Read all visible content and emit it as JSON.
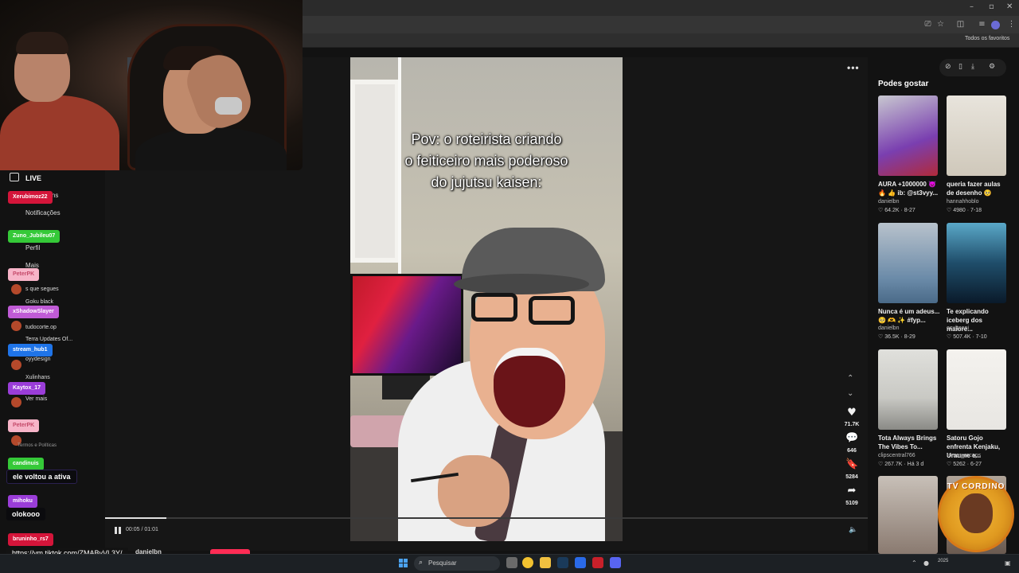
{
  "browser": {
    "bookmarks_label": "Todos os favoritos"
  },
  "sidebar": {
    "live_label": "LIVE",
    "items": [
      {
        "label": "Mensagens"
      },
      {
        "label": "Notificações"
      },
      {
        "label": "Perfil"
      },
      {
        "label": "Mais"
      }
    ],
    "following_heading": "s que segues",
    "following": [
      {
        "label": "Goku black"
      },
      {
        "label": "tudocorte.op"
      },
      {
        "label": "Terra Updates Of..."
      },
      {
        "label": "oyydesign"
      },
      {
        "label": "Xulinhans"
      }
    ],
    "see_more": "Ver mais",
    "footer": "Termos e Políticas"
  },
  "chat": {
    "messages": [
      {
        "user": "Xerubimoz22",
        "color": "#d4153a"
      },
      {
        "user": "Zuno_Jubileu07",
        "color": "#35c938"
      },
      {
        "user": "PeterPK",
        "color": "#f7b4c8"
      },
      {
        "user": "xShadowSlayer",
        "color": "#c05bd6"
      },
      {
        "user": "stream_hub1",
        "color": "#1f74e8"
      },
      {
        "user": "Kaytox_17",
        "color": "#9a3dd8"
      },
      {
        "user": "PeterPK",
        "color": "#f7b4c8"
      },
      {
        "user": "candinuis",
        "color": "#35c938",
        "text": "ele voltou a ativa"
      },
      {
        "user": "mihoku",
        "color": "#9a3dd8",
        "text": "olokooo"
      },
      {
        "user": "bruninho_rs7",
        "color": "#d4153a",
        "text": "https://vm.tiktok.com/ZMABvVL3Y/"
      }
    ]
  },
  "video": {
    "caption": "Pov: o roteirista criando\no feiticeiro mais poderoso\ndo jujutsu kaisen:",
    "time": "00:05 / 01:01",
    "progress": 0.08,
    "author": "danielbn",
    "actions": {
      "likes": "71.7K",
      "comments": "646",
      "saves": "5284",
      "shares": "5109"
    }
  },
  "recommendations": {
    "heading": "Podes gostar",
    "items": [
      {
        "title": "AURA +1000000 😈 🔥 👍 ib: @st3vyy...",
        "author": "danielbn",
        "likes": "64.2K",
        "date": "8-27",
        "thumb_color": "#7a3fb0"
      },
      {
        "title": "queria fazer aulas de desenho 🥺",
        "author": "hannahhoblo",
        "likes": "4980",
        "date": "7-18",
        "thumb_color": "#d8d2c8"
      },
      {
        "title": "Nunca é um adeus... 🥺 🫶 ✨ #fyp...",
        "author": "danielbn",
        "likes": "36.5K",
        "date": "8-29",
        "thumb_color": "#6a8aa8"
      },
      {
        "title": "Te explicando iceberg dos maiore...",
        "author": "ocultoeni",
        "likes": "507.4K",
        "date": "7-10",
        "thumb_color": "#1f4d6a"
      },
      {
        "title": "Tota Always Brings The Vibes To...",
        "author": "clipscentral766",
        "likes": "267.7K",
        "date": "Há 3 d",
        "thumb_color": "#c9c9c4"
      },
      {
        "title": "Satoru Gojo enfrenta Kenjaku, Uraume e...",
        "author": "romer_recaps",
        "likes": "5262",
        "date": "6-27",
        "thumb_color": "#e8e6e2"
      },
      {
        "title": "",
        "author": "",
        "likes": "",
        "date": "",
        "thumb_color": "#8a7a70"
      },
      {
        "title": "",
        "author": "",
        "likes": "",
        "date": "",
        "thumb_color": "#6a5a50"
      }
    ]
  },
  "taskbar": {
    "search_placeholder": "Pesquisar",
    "tray_date": "2025"
  },
  "overlay": {
    "channel_logo_text": "TV CORDINO"
  }
}
